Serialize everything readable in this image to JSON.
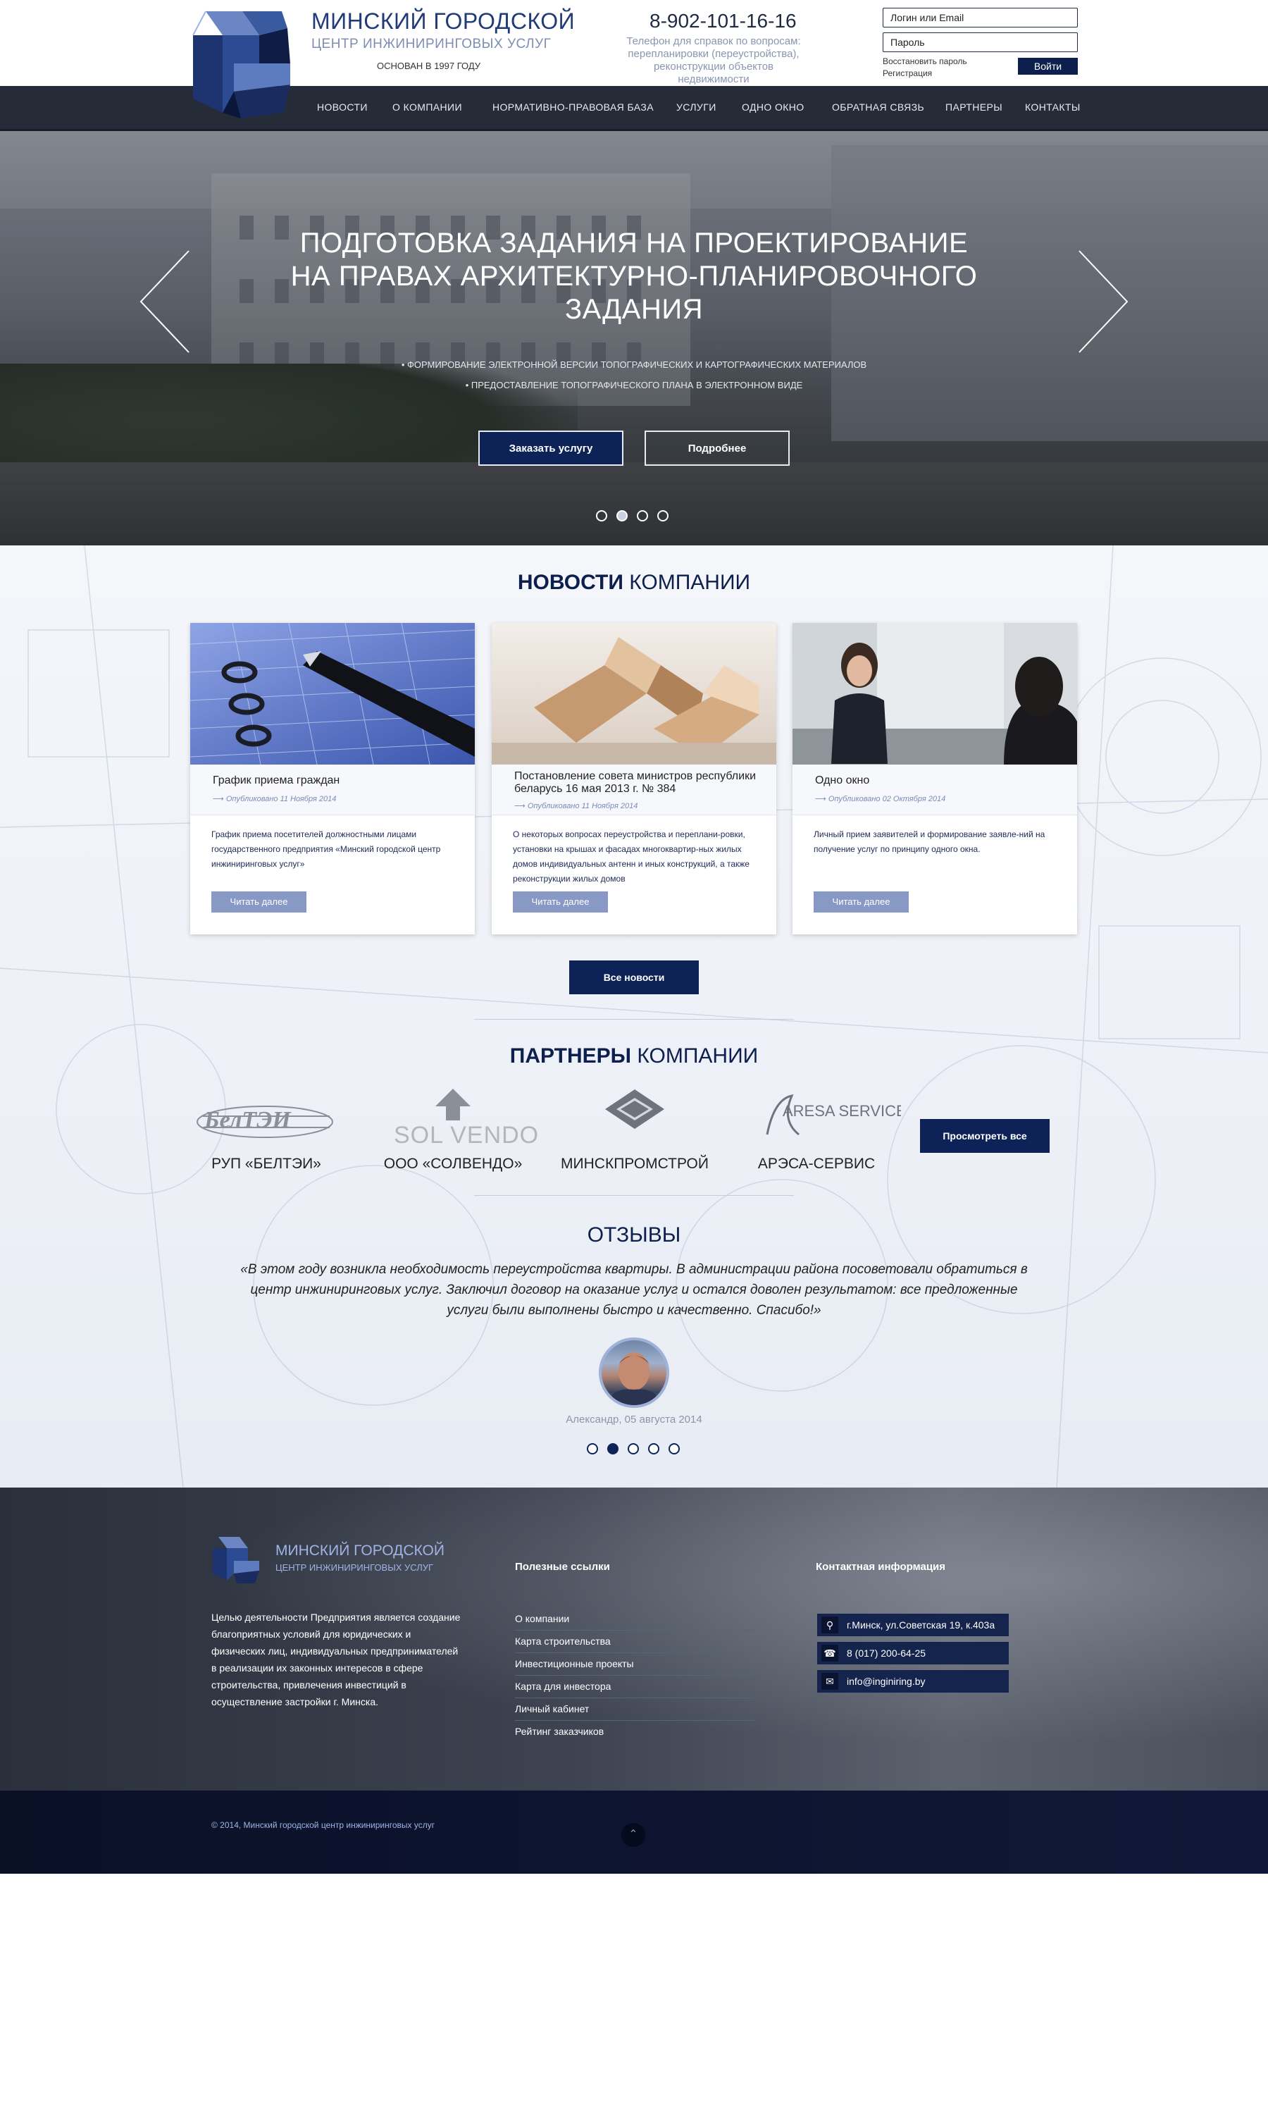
{
  "header": {
    "title": "МИНСКИЙ ГОРОДСКОЙ",
    "subtitle": "ЦЕНТР ИНЖИНИРИНГОВЫХ УСЛУГ",
    "founded": "ОСНОВАН В 1997 ГОДУ",
    "phone": "8-902-101-16-16",
    "phone_note": "Телефон для справок по вопросам: перепланировки (переустройства), реконструкции объектов недвижимости",
    "login_placeholder": "Логин или Email",
    "password_placeholder": "Пароль",
    "restore_password": "Восстановить пароль",
    "register": "Регистрация",
    "login_button": "Войти"
  },
  "nav": {
    "items": [
      "НОВОСТИ",
      "О КОМПАНИИ",
      "НОРМАТИВНО-ПРАВОВАЯ БАЗА",
      "УСЛУГИ",
      "ОДНО ОКНО",
      "ОБРАТНАЯ СВЯЗЬ",
      "ПАРТНЕРЫ",
      "КОНТАКТЫ"
    ]
  },
  "hero": {
    "title_line1": "ПОДГОТОВКА ЗАДАНИЯ НА ПРОЕКТИРОВАНИЕ",
    "title_line2": "НА ПРАВАХ АРХИТЕКТУРНО-ПЛАНИРОВОЧНОГО",
    "title_line3": "ЗАДАНИЯ",
    "bullet1": "• ФОРМИРОВАНИЕ ЭЛЕКТРОННОЙ ВЕРСИИ ТОПОГРАФИЧЕСКИХ И КАРТОГРАФИЧЕСКИХ МАТЕРИАЛОВ",
    "bullet2": "• ПРЕДОСТАВЛЕНИЕ ТОПОГРАФИЧЕСКОГО ПЛАНА В  ЭЛЕКТРОННОМ ВИДЕ",
    "order_button": "Заказать услугу",
    "more_button": "Подробнее",
    "slide_count": 4,
    "active_slide": 2
  },
  "news": {
    "title_bold": "НОВОСТИ",
    "title_rest": " КОМПАНИИ",
    "cards": [
      {
        "title": "График приема граждан",
        "date": "⟶ Опубликовано 11 Ноября 2014",
        "text": "График приема посетителей должностными лицами государственного предприятия «Минский городской центр инжиниринговых услуг»",
        "button": "Читать далее",
        "image": "notebook-pen-image"
      },
      {
        "title": "Постановление совета министров республики беларусь 16 мая 2013 г. № 384",
        "date": "⟶ Опубликовано 11 Ноября 2014",
        "text": "О некоторых вопросах переустройства и переплани-ровки, установки на крышах и фасадах многоквартир-ных жилых домов индивидуальных антенн и иных конструкций, а также реконструкции жилых домов",
        "button": "Читать далее",
        "image": "house-model-image"
      },
      {
        "title": "Одно окно",
        "date": "⟶ Опубликовано 02 Октября 2014",
        "text": "Личный прием заявителей и формирование заявле-ний на получение услуг по принципу одного окна.",
        "button": "Читать далее",
        "image": "office-reception-image"
      }
    ],
    "all_button": "Все новости"
  },
  "partners": {
    "title_bold": "ПАРТНЕРЫ",
    "title_rest": " КОМПАНИИ",
    "items": [
      {
        "name": "РУП «БЕЛТЭИ»",
        "logo_text": "БелТЭИ"
      },
      {
        "name": "ООО «СОЛВЕНДО»",
        "logo_text": "SOL VENDO"
      },
      {
        "name": "МИНСКПРОМСТРОЙ",
        "logo_text": ""
      },
      {
        "name": "АРЭСА-СЕРВИС",
        "logo_text": "ARESA SERVICE"
      }
    ],
    "view_all": "Просмотреть все"
  },
  "reviews": {
    "title": "ОТЗЫВЫ",
    "text": "«В этом году возникла необходимость переустройства квартиры. В администрации района посоветовали обратиться в центр инжиниринговых услуг. Заключил договор на оказание услуг и остался доволен результатом: все предложенные услуги были выполнены быстро и качественно. Спасибо!»",
    "author": "Александр, 05 августа 2014",
    "slide_count": 5,
    "active_slide": 2
  },
  "footer": {
    "title": "МИНСКИЙ ГОРОДСКОЙ",
    "subtitle": "ЦЕНТР ИНЖИНИРИНГОВЫХ УСЛУГ",
    "about": "Целью деятельности Предприятия является создание благоприятных условий для юридических и физических лиц, индивидуальных предпринимателей в реализации их законных интересов в сфере строительства, привлечения инвестиций в осуществление застройки г. Минска.",
    "links_title": "Полезные ссылки",
    "links": [
      "О компании",
      "Карта строительства",
      "Инвестиционные проекты",
      "Карта для инвестора",
      "Личный кабинет",
      "Рейтинг заказчиков"
    ],
    "contacts_title": "Контактная информация",
    "address": "г.Минск, ул.Советская 19, к.403а",
    "phone": "8 (017) 200-64-25",
    "email": "info@inginiring.by",
    "copyright": "© 2014, Минский городской центр инжиниринговых услуг"
  },
  "colors": {
    "brand_dark": "#0d2358",
    "nav_bg": "#262b38",
    "accent_light": "#9fb4e6",
    "card_button": "#8899c6"
  }
}
